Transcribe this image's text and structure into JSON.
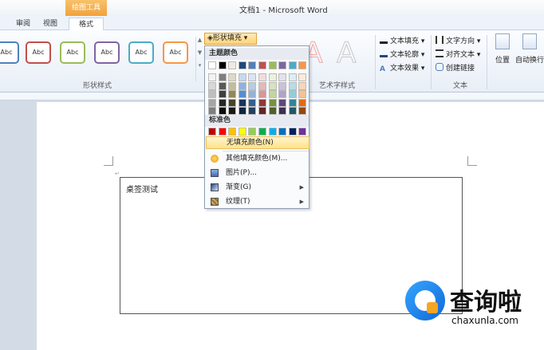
{
  "window": {
    "title": "文档1 - Microsoft Word",
    "context_tab": "绘图工具"
  },
  "tabs": [
    {
      "label": "审阅"
    },
    {
      "label": "视图"
    },
    {
      "label": "格式"
    }
  ],
  "ribbon": {
    "shape_styles": {
      "label": "形状样式",
      "items": [
        {
          "text": "Abc",
          "color": "#4f81bd"
        },
        {
          "text": "Abc",
          "color": "#c0504d"
        },
        {
          "text": "Abc",
          "color": "#9bbb59"
        },
        {
          "text": "Abc",
          "color": "#8064a2"
        },
        {
          "text": "Abc",
          "color": "#4bacc6"
        },
        {
          "text": "Abc",
          "color": "#f79646"
        }
      ],
      "fill_button": "形状填充"
    },
    "wordart": {
      "label": "艺术字样式",
      "glyph": "A",
      "text_fill": "文本填充",
      "text_outline": "文本轮廓",
      "text_effects": "文本效果"
    },
    "text_group": {
      "label": "文本",
      "direction": "文字方向",
      "align": "对齐文本",
      "link": "创建链接"
    },
    "arrange": {
      "position": "位置",
      "wrap": "自动换行"
    }
  },
  "menu": {
    "theme_colors_label": "主题颜色",
    "theme_top": [
      "#ffffff",
      "#000000",
      "#eeece1",
      "#1f497d",
      "#4f81bd",
      "#c0504d",
      "#9bbb59",
      "#8064a2",
      "#4bacc6",
      "#f79646"
    ],
    "theme_shades": [
      [
        "#f2f2f2",
        "#7f7f7f",
        "#ddd9c3",
        "#c6d9f0",
        "#dbe5f1",
        "#f2dcdb",
        "#ebf1dd",
        "#e5e0ec",
        "#dbeef3",
        "#fdeada"
      ],
      [
        "#d8d8d8",
        "#595959",
        "#c4bd97",
        "#8db3e2",
        "#b8cce4",
        "#e5b9b7",
        "#d7e3bc",
        "#ccc1d9",
        "#b7dde8",
        "#fbd5b5"
      ],
      [
        "#bfbfbf",
        "#3f3f3f",
        "#938953",
        "#548dd4",
        "#95b3d7",
        "#d99694",
        "#c3d69b",
        "#b2a2c7",
        "#92cddc",
        "#fac08f"
      ],
      [
        "#a5a5a5",
        "#262626",
        "#494429",
        "#17365d",
        "#366092",
        "#953734",
        "#76923c",
        "#5f497a",
        "#31859b",
        "#e36c09"
      ],
      [
        "#7f7f7f",
        "#0c0c0c",
        "#1d1b10",
        "#0f243e",
        "#244061",
        "#632423",
        "#4f6128",
        "#3f3151",
        "#205867",
        "#974806"
      ]
    ],
    "standard_colors_label": "标准色",
    "standard_colors": [
      "#c00000",
      "#ff0000",
      "#ffc000",
      "#ffff00",
      "#92d050",
      "#00b050",
      "#00b0f0",
      "#0070c0",
      "#002060",
      "#7030a0"
    ],
    "no_fill": "无填充颜色(N)",
    "more_colors": "其他填充颜色(M)...",
    "picture": "图片(P)...",
    "gradient": "渐变(G)",
    "texture": "纹理(T)"
  },
  "document": {
    "textbox_text": "桌签测试",
    "para_mark": "↵"
  },
  "watermark": {
    "brand": "查询啦",
    "url": "chaxunla.com"
  }
}
